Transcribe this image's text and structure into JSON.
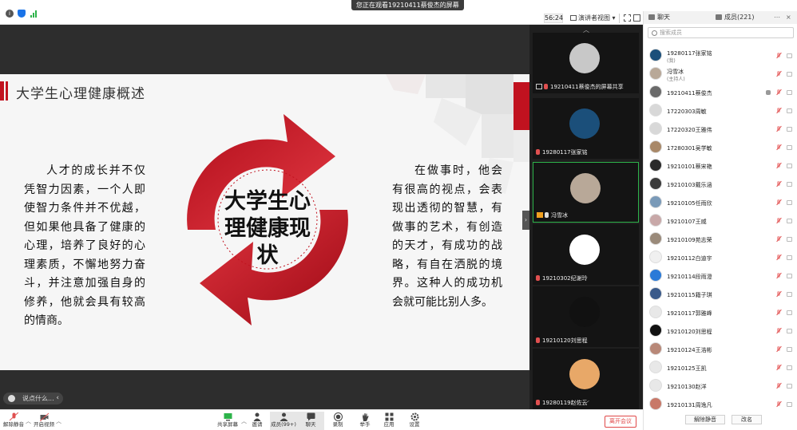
{
  "topbar": {
    "watch_banner": "您正在观看19210411蔡俊杰的屏幕",
    "timer": "56:24",
    "view_button": "演讲者视图"
  },
  "slide": {
    "title": "大学生心理健康概述",
    "center_text": "大学生心理健康现状",
    "left_paragraph": "人才的成长并不仅凭智力因素，一个人即使智力条件并不优越，但如果他具备了健康的心理，培养了良好的心理素质，不懈地努力奋斗，并注意加强自身的修养，他就会具有较高的情商。",
    "right_paragraph": "在做事时，他会有很高的视点，会表现出透彻的智慧，有做事的艺术，有创造的天才，有成功的战略，有自在洒脱的境界。这种人的成功机会就可能比别人多。"
  },
  "chat_pill": {
    "placeholder": "说点什么..."
  },
  "videos": [
    {
      "label": "19210411蔡俊杰的屏幕共享",
      "avatar_color": "#c8c8c8",
      "active": false
    },
    {
      "label": "19280117张家铭",
      "avatar_color": "#1b4f7a",
      "active": false
    },
    {
      "label": "冯雪冰",
      "avatar_color": "#b8a898",
      "active": true
    },
    {
      "label": "19210302纪谢玲",
      "avatar_color": "#ffffff",
      "active": false
    },
    {
      "label": "19210120刘思程",
      "avatar_color": "#111111",
      "active": false
    },
    {
      "label": "19280119赵佐云",
      "avatar_color": "#e8a868",
      "active": false
    }
  ],
  "panel": {
    "tab_chat": "聊天",
    "tab_members": "成员(221)",
    "search_placeholder": "搜索成员",
    "members": [
      {
        "name": "19280117张家铭",
        "role": "(我)",
        "color": "#1b4f7a"
      },
      {
        "name": "冯雪冰",
        "role": "(主持人)",
        "color": "#b8a898"
      },
      {
        "name": "19210411蔡俊杰",
        "role": "",
        "color": "#6a6a6a"
      },
      {
        "name": "17220303周敏",
        "role": "",
        "color": "#d8d8d8"
      },
      {
        "name": "17220320王雅伟",
        "role": "",
        "color": "#d8d8d8"
      },
      {
        "name": "17280301吴学敏",
        "role": "",
        "color": "#a88868"
      },
      {
        "name": "19210101蔡宋艳",
        "role": "",
        "color": "#2a2a2a"
      },
      {
        "name": "19210103戴乐涵",
        "role": "",
        "color": "#3a3a3a"
      },
      {
        "name": "19210105任雨欣",
        "role": "",
        "color": "#7a9ab8"
      },
      {
        "name": "19210107王威",
        "role": "",
        "color": "#c8a8a8"
      },
      {
        "name": "19210109苑志荣",
        "role": "",
        "color": "#9a8a7a"
      },
      {
        "name": "19210112白迪宇",
        "role": "",
        "color": "#f0f0f0"
      },
      {
        "name": "19210114段雨澄",
        "role": "",
        "color": "#2a7ad8"
      },
      {
        "name": "19210115籍子琪",
        "role": "",
        "color": "#3a5a8a"
      },
      {
        "name": "19210117郭雅峰",
        "role": "",
        "color": "#e8e8e8"
      },
      {
        "name": "19210120刘思程",
        "role": "",
        "color": "#111111"
      },
      {
        "name": "19210124王浩彬",
        "role": "",
        "color": "#b88878"
      },
      {
        "name": "19210125王凯",
        "role": "",
        "color": "#e8e8e8"
      },
      {
        "name": "19210130赵洋",
        "role": "",
        "color": "#e8e8e8"
      },
      {
        "name": "19210131周逸凡",
        "role": "",
        "color": "#c87868"
      }
    ],
    "btn_mute_all": "解除静音",
    "btn_rename": "改名"
  },
  "toolbar": {
    "unmute": "解除静音",
    "start_video": "开启视频",
    "share_screen": "共享屏幕",
    "invite": "邀请",
    "members": "成员(99+)",
    "chat": "聊天",
    "record": "录制",
    "raise_hand": "举手",
    "apps": "应用",
    "settings": "设置",
    "leave": "离开会议"
  }
}
